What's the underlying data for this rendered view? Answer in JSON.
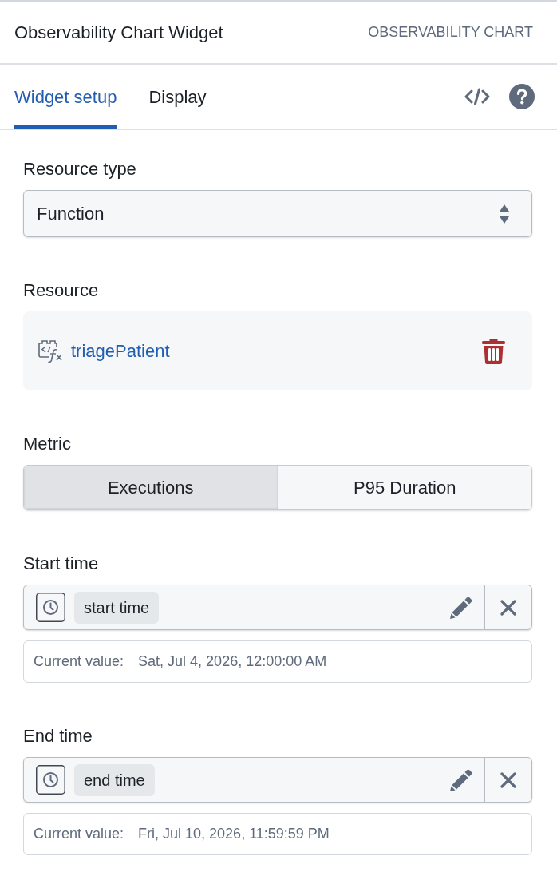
{
  "header": {
    "title": "Observability Chart Widget",
    "type_label": "OBSERVABILITY CHART"
  },
  "tabs": [
    {
      "label": "Widget setup",
      "selected": true
    },
    {
      "label": "Display",
      "selected": false
    }
  ],
  "fields": [
    {
      "kind": "select",
      "label": "Resource type",
      "value": "Function"
    },
    {
      "kind": "resource",
      "label": "Resource",
      "value": "triagePatient"
    },
    {
      "kind": "segmented",
      "label": "Metric",
      "options": [
        {
          "label": "Executions",
          "selected": true
        },
        {
          "label": "P95 Duration",
          "selected": false
        }
      ]
    },
    {
      "kind": "time",
      "label": "Start time",
      "chip": "start time",
      "current_label": "Current value:",
      "current_value": "Sat, Jul 4, 2026, 12:00:00 AM"
    },
    {
      "kind": "time",
      "label": "End time",
      "chip": "end time",
      "current_label": "Current value:",
      "current_value": "Fri, Jul 10, 2026, 11:59:59 PM"
    }
  ]
}
